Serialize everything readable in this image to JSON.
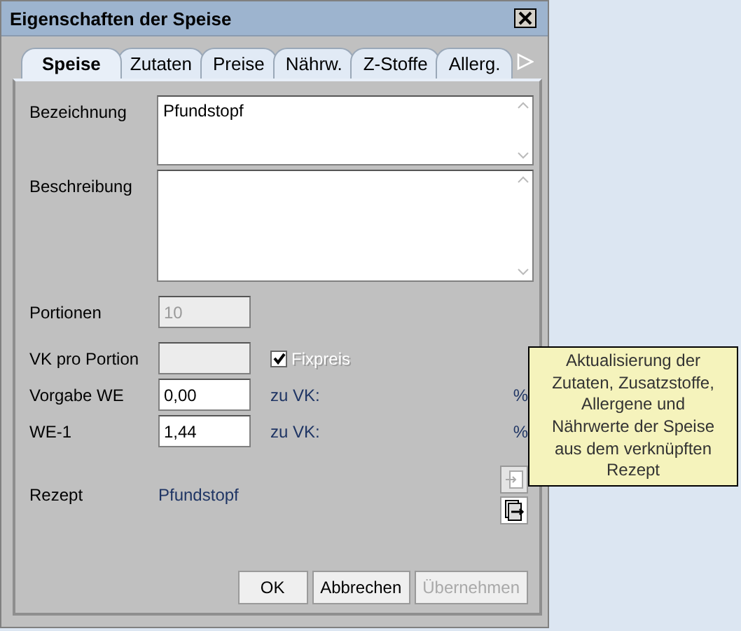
{
  "window": {
    "title": "Eigenschaften der Speise"
  },
  "tabs": [
    {
      "label": "Speise",
      "selected": true
    },
    {
      "label": "Zutaten",
      "selected": false
    },
    {
      "label": "Preise",
      "selected": false
    },
    {
      "label": "Nährw.",
      "selected": false
    },
    {
      "label": "Z-Stoffe",
      "selected": false
    },
    {
      "label": "Allerg.",
      "selected": false
    }
  ],
  "fields": [
    {
      "kind": "textarea",
      "label": "Bezeichnung",
      "value": "Pfundstopf"
    },
    {
      "kind": "textarea",
      "label": "Beschreibung"
    },
    {
      "kind": "input",
      "label": "Portionen",
      "value": "10",
      "disabled": true
    },
    {
      "kind": "input",
      "label": "VK pro Portion",
      "disabled": true,
      "checkbox": {
        "label": "Fixpreis",
        "checked": true,
        "disabled": true
      }
    },
    {
      "kind": "input",
      "label": "Vorgabe WE",
      "value": "0,00",
      "disabled": false,
      "ratio_label": "zu VK:",
      "unit": "%"
    },
    {
      "kind": "input",
      "label": "WE-1",
      "value": "1,44",
      "disabled": false,
      "ratio_label": "zu VK:",
      "unit": "%"
    },
    {
      "kind": "link",
      "label": "Rezept",
      "value": "Pfundstopf"
    }
  ],
  "buttons": [
    {
      "label": "OK",
      "disabled": false
    },
    {
      "label": "Abbrechen",
      "disabled": false
    },
    {
      "label": "Übernehmen",
      "disabled": true
    }
  ],
  "tooltip": {
    "text": "Aktualisierung der Zutaten, Zusatzstoffe, Allergene und Nährwerte der Speise aus dem verknüpften Rezept"
  }
}
